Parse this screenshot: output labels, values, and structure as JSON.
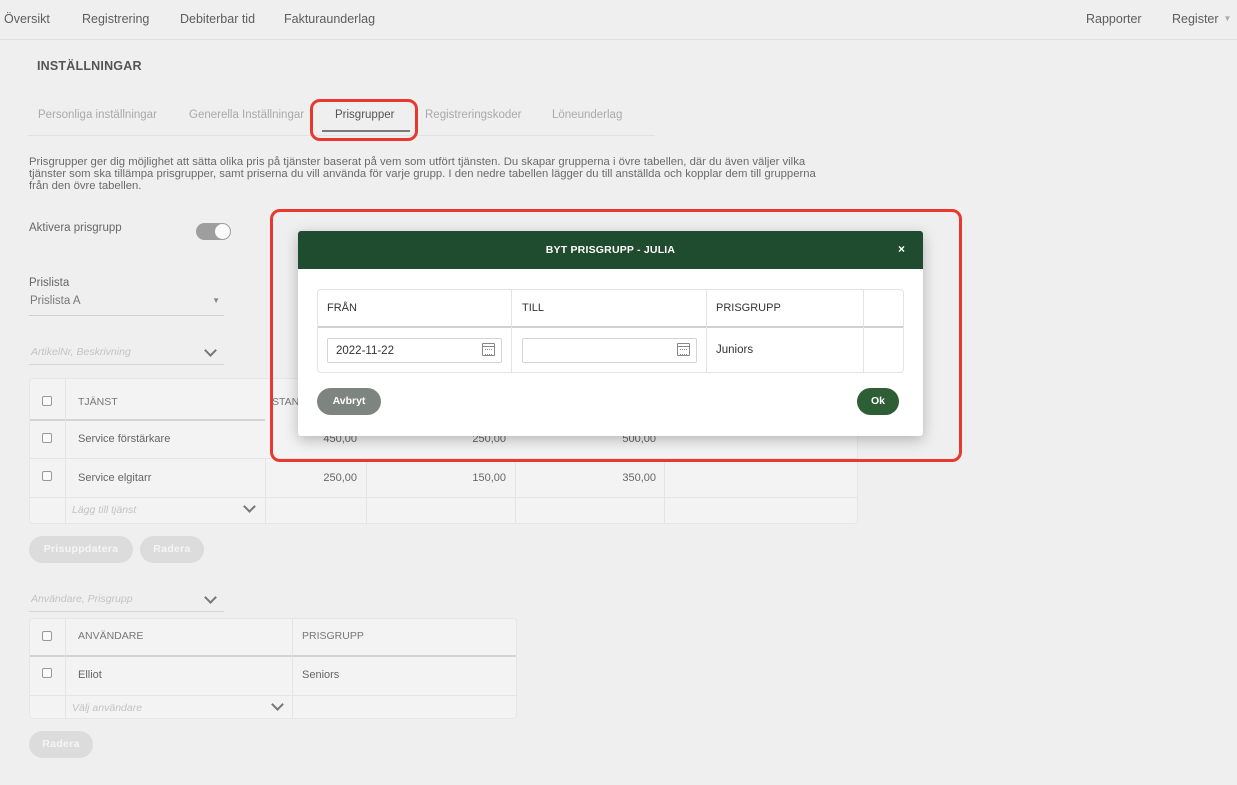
{
  "nav": {
    "left": [
      "Översikt",
      "Registrering",
      "Debiterbar tid",
      "Fakturaunderlag"
    ],
    "rapporter": "Rapporter",
    "register": "Register"
  },
  "page_title": "INSTÄLLNINGAR",
  "tabs": [
    "Personliga inställningar",
    "Generella Inställningar",
    "Prisgrupper",
    "Registreringskoder",
    "Löneunderlag"
  ],
  "description": "Prisgrupper ger dig möjlighet att sätta olika pris på tjänster baserat på vem som utfört tjänsten. Du skapar grupperna i övre tabellen, där du även väljer vilka tjänster som ska tillämpa prisgrupper, samt priserna du vill använda för varje grupp. I den nedre tabellen lägger du till anställda och kopplar dem till grupperna från den övre tabellen.",
  "activate": {
    "label": "Aktivera prisgrupp",
    "enabled": true
  },
  "pricelist": {
    "label": "Prislista",
    "value": "Prislista A"
  },
  "service_filter_placeholder": "ArtikelNr, Beskrivning",
  "services_table": {
    "header_service": "TJÄNST",
    "header_partial": "STAN",
    "rows": [
      {
        "name": "Service förstärkare",
        "v1": "450,00",
        "v2": "250,00",
        "v3": "500,00"
      },
      {
        "name": "Service elgitarr",
        "v1": "250,00",
        "v2": "150,00",
        "v3": "350,00"
      }
    ],
    "add_placeholder": "Lägg till tjänst"
  },
  "buttons": {
    "prisuppdatera": "Prisuppdatera",
    "radera": "Radera",
    "radera2": "Radera"
  },
  "user_filter_placeholder": "Användare, Prisgrupp",
  "users_table": {
    "header_user": "ANVÄNDARE",
    "header_group": "PRISGRUPP",
    "rows": [
      {
        "user": "Elliot",
        "group": "Seniors"
      }
    ],
    "add_placeholder": "Välj användare"
  },
  "modal": {
    "title": "BYT PRISGRUPP - JULIA",
    "close": "×",
    "col_from": "FRÅN",
    "col_to": "TILL",
    "col_group": "PRISGRUPP",
    "from_value": "2022-11-22",
    "to_value": "",
    "group_value": "Juniors",
    "cancel": "Avbryt",
    "ok": "Ok"
  },
  "colors": {
    "modal_header": "#1f4b2e",
    "ok_button": "#2d5e35",
    "annotation": "#e8382f"
  }
}
